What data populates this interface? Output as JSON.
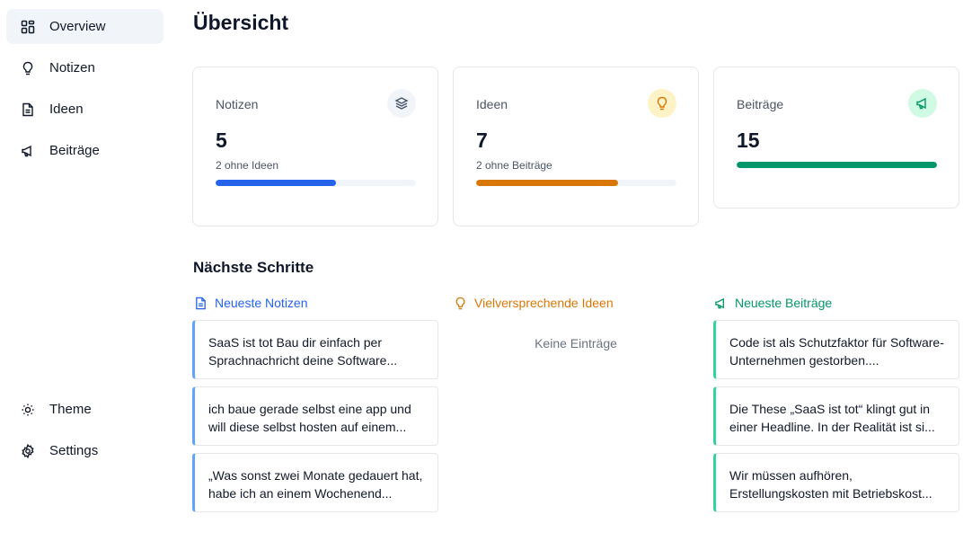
{
  "sidebar": {
    "items": [
      {
        "label": "Overview",
        "icon": "dashboard-icon"
      },
      {
        "label": "Notizen",
        "icon": "lightbulb-icon"
      },
      {
        "label": "Ideen",
        "icon": "document-icon"
      },
      {
        "label": "Beiträge",
        "icon": "megaphone-icon"
      }
    ],
    "bottom": [
      {
        "label": "Theme",
        "icon": "sun-icon"
      },
      {
        "label": "Settings",
        "icon": "gear-icon"
      }
    ]
  },
  "main": {
    "title": "Übersicht",
    "cards": [
      {
        "label": "Notizen",
        "value": "5",
        "sub": "2 ohne Ideen",
        "progress": 0.6,
        "color": "#2563eb",
        "icon": "layers-icon",
        "icon_bg": "#f1f5f9"
      },
      {
        "label": "Ideen",
        "value": "7",
        "sub": "2 ohne Beiträge",
        "progress": 0.71,
        "color": "#d97706",
        "icon": "lightbulb-icon",
        "icon_bg": "#fef3c7"
      },
      {
        "label": "Beiträge",
        "value": "15",
        "sub": "",
        "progress": 1.0,
        "color": "#059669",
        "icon": "megaphone-icon",
        "icon_bg": "#d1fae5"
      }
    ],
    "next_steps": {
      "title": "Nächste Schritte",
      "columns": [
        {
          "title": "Neueste Notizen",
          "color": "#2563eb",
          "icon": "document-icon",
          "entries": [
            "SaaS ist tot Bau dir einfach per Sprachnachricht deine Software...",
            "ich baue gerade selbst eine app und will diese selbst hosten auf einem...",
            "„Was sonst zwei Monate gedauert hat, habe ich an einem Wochenend..."
          ]
        },
        {
          "title": "Vielversprechende Ideen",
          "color": "#d97706",
          "icon": "lightbulb-icon",
          "empty": "Keine Einträge"
        },
        {
          "title": "Neueste Beiträge",
          "color": "#059669",
          "icon": "megaphone-icon",
          "entries": [
            "Code ist als Schutzfaktor für Software-Unternehmen gestorben....",
            "Die These „SaaS ist tot“ klingt gut in einer Headline. In der Realität ist si...",
            "Wir müssen aufhören, Erstellungskosten mit Betriebskost..."
          ]
        }
      ]
    }
  }
}
